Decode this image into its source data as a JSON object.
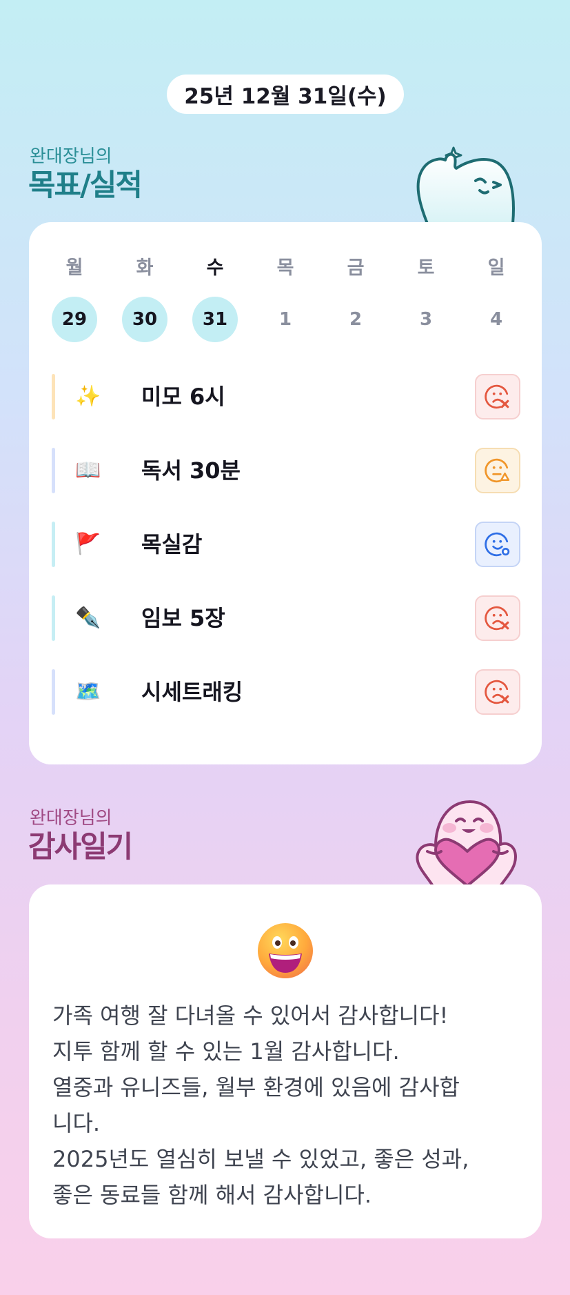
{
  "date_label": "25년 12월 31일(수)",
  "goals_section": {
    "subtitle": "완대장님의",
    "title": "목표/실적"
  },
  "week": {
    "days": [
      {
        "weekday": "월",
        "num": "29",
        "done": true,
        "today": false
      },
      {
        "weekday": "화",
        "num": "30",
        "done": true,
        "today": false
      },
      {
        "weekday": "수",
        "num": "31",
        "done": true,
        "today": true
      },
      {
        "weekday": "목",
        "num": "1",
        "done": false,
        "today": false
      },
      {
        "weekday": "금",
        "num": "2",
        "done": false,
        "today": false
      },
      {
        "weekday": "토",
        "num": "3",
        "done": false,
        "today": false
      },
      {
        "weekday": "일",
        "num": "4",
        "done": false,
        "today": false
      }
    ]
  },
  "goals": [
    {
      "emoji": "✨",
      "label": "미모 6시",
      "status": "fail",
      "bar_color": "#fde3b8"
    },
    {
      "emoji": "📖",
      "label": "독서 30분",
      "status": "partial",
      "bar_color": "#d6e0fb"
    },
    {
      "emoji": "🚩",
      "label": "목실감",
      "status": "ok",
      "bar_color": "#c6eef4"
    },
    {
      "emoji": "✒️",
      "label": "임보 5장",
      "status": "fail",
      "bar_color": "#c6eef4"
    },
    {
      "emoji": "🗺️",
      "label": "시세트래킹",
      "status": "fail",
      "bar_color": "#d6e0fb"
    }
  ],
  "status_icons": {
    "fail": "sad-face-x-icon",
    "partial": "neutral-face-warning-icon",
    "ok": "smile-face-check-icon"
  },
  "colors": {
    "fail": "#e4573f",
    "partial": "#f0962a",
    "ok": "#2f6fe6",
    "accent_teal": "#1f7f89",
    "accent_plum": "#8c3a73"
  },
  "gratitude_section": {
    "subtitle": "완대장님의",
    "title": "감사일기"
  },
  "gratitude": {
    "emoji_icon": "grinning-face-icon",
    "lines": [
      "가족 여행 잘 다녀올 수 있어서 감사합니다!",
      "지투 함께 할 수 있는 1월 감사합니다.",
      "열중과 유니즈들, 월부 환경에 있음에 감사합",
      "니다.",
      "2025년도 열심히 보낼 수 있었고, 좋은 성과,",
      "좋은 동료들 함께 해서 감사합니다."
    ]
  }
}
